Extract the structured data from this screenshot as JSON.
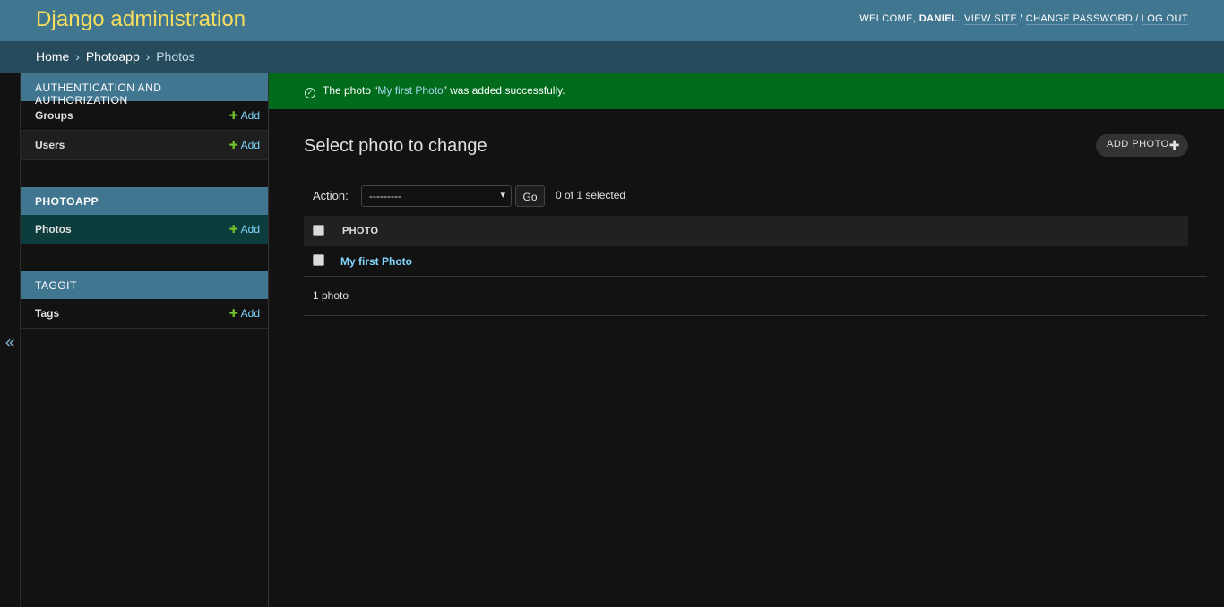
{
  "header": {
    "site_name": "Django administration",
    "welcome": "Welcome,",
    "username": "Daniel",
    "view_site": "View site",
    "change_password": "Change password",
    "log_out": "Log out",
    "sep": "/"
  },
  "breadcrumbs": {
    "home": "Home",
    "app": "Photoapp",
    "current": "Photos",
    "arrow": "›"
  },
  "sidebar": {
    "toggle_glyph": "«",
    "add_label": "Add",
    "add_plus": "✚",
    "modules": [
      {
        "caption": "Authentication and Authorization",
        "rows": [
          {
            "name": "Groups"
          },
          {
            "name": "Users"
          }
        ]
      },
      {
        "caption": "Photoapp",
        "rows": [
          {
            "name": "Photos"
          }
        ]
      },
      {
        "caption": "Taggit",
        "rows": [
          {
            "name": "Tags"
          }
        ]
      }
    ]
  },
  "message": {
    "prefix": "The photo “",
    "link": "My first Photo",
    "suffix": "” was added successfully."
  },
  "content": {
    "title": "Select photo to change",
    "add_button": "Add photo",
    "add_plus": "✚",
    "action_label": "Action:",
    "action_selected": "---------",
    "caret": "▾",
    "go_button": "Go",
    "selection_counter": "0 of 1 selected",
    "column_header": "Photo",
    "rows": [
      "My first Photo"
    ],
    "paginator": "1 photo"
  },
  "colors": {
    "header_bg": "#417690",
    "breadcrumbs_bg": "#264b5d",
    "success_bg": "#006b1b",
    "link": "#81d4fa",
    "add_plus": "#70bf2b",
    "current_row_bg": "#0c3c3c"
  }
}
